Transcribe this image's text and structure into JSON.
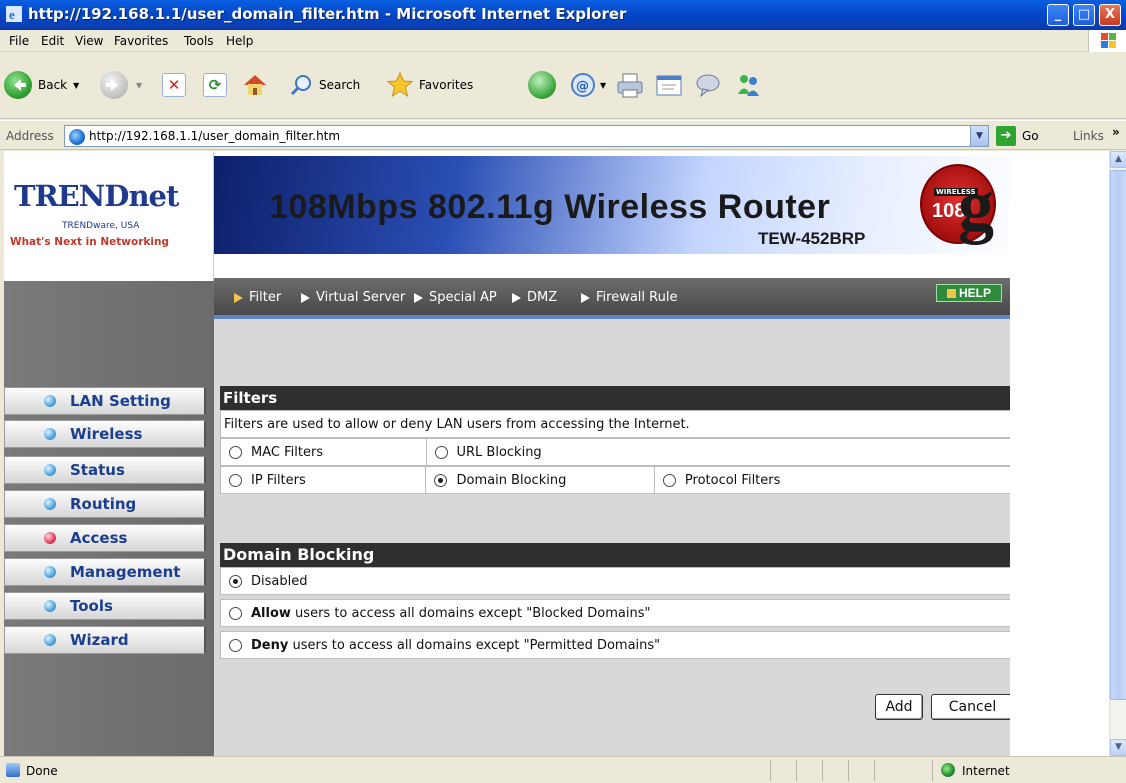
{
  "window": {
    "title": "http://192.168.1.1/user_domain_filter.htm - Microsoft Internet Explorer",
    "controls": {
      "minimize": "_",
      "maximize": "□",
      "close": "X"
    }
  },
  "menu": [
    "File",
    "Edit",
    "View",
    "Favorites",
    "Tools",
    "Help"
  ],
  "toolbar": {
    "back": "Back",
    "search": "Search",
    "favorites": "Favorites"
  },
  "address": {
    "label": "Address",
    "url": "http://192.168.1.1/user_domain_filter.htm",
    "go": "Go",
    "links": "Links"
  },
  "router": {
    "logo": {
      "brand": "TRENDnet",
      "sub": "TRENDware, USA",
      "tagline": "What's Next in Networking"
    },
    "banner": {
      "title": "108Mbps 802.11g Wireless Router",
      "model": "TEW-452BRP",
      "badge_wireless": "WIRELESS",
      "badge_108": "108",
      "badge_letter": "g"
    },
    "topnav": [
      "Filter",
      "Virtual Server",
      "Special AP",
      "DMZ",
      "Firewall Rule"
    ],
    "topnav_selected": "Filter",
    "help": "HELP",
    "sidebar": [
      {
        "label": "LAN Setting",
        "active": false
      },
      {
        "label": "Wireless",
        "active": false
      },
      {
        "label": "Status",
        "active": false
      },
      {
        "label": "Routing",
        "active": false
      },
      {
        "label": "Access",
        "active": true
      },
      {
        "label": "Management",
        "active": false
      },
      {
        "label": "Tools",
        "active": false
      },
      {
        "label": "Wizard",
        "active": false
      }
    ],
    "filters": {
      "heading": "Filters",
      "description": "Filters are used to allow or deny LAN users from accessing the Internet.",
      "options": [
        {
          "label": "MAC Filters",
          "checked": false
        },
        {
          "label": "URL Blocking",
          "checked": false
        },
        {
          "label": "IP Filters",
          "checked": false
        },
        {
          "label": "Domain Blocking",
          "checked": true
        },
        {
          "label": "Protocol Filters",
          "checked": false
        }
      ]
    },
    "domain_blocking": {
      "heading": "Domain Blocking",
      "disabled": "Disabled",
      "allow_bold": "Allow",
      "allow_rest": " users to access all domains except \"Blocked Domains\"",
      "deny_bold": "Deny",
      "deny_rest": " users to access all domains except \"Permitted Domains\"",
      "selected": "Disabled"
    },
    "buttons": {
      "add": "Add",
      "cancel": "Cancel"
    }
  },
  "status": {
    "text": "Done",
    "zone": "Internet"
  }
}
